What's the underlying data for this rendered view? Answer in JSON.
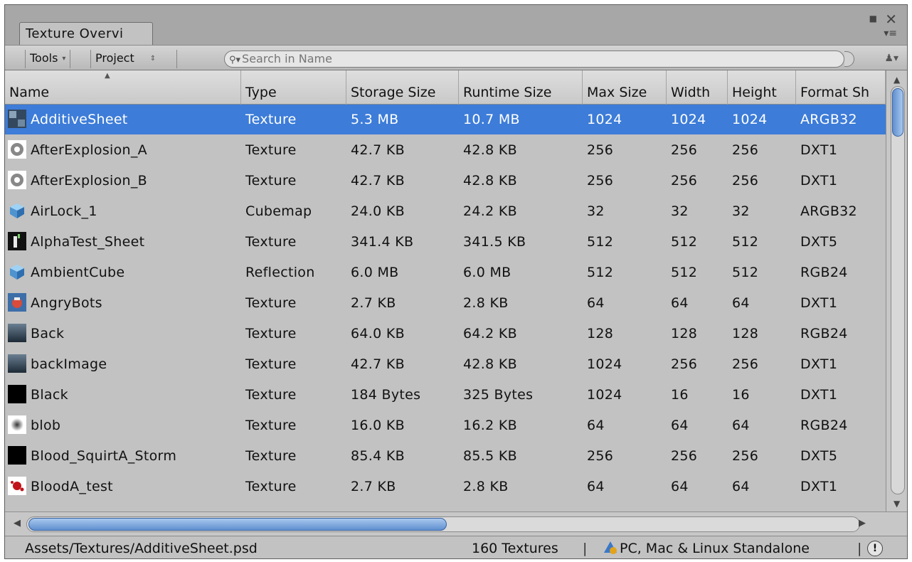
{
  "window": {
    "tab_title": "Texture Overvi"
  },
  "toolbar": {
    "tools_label": "Tools",
    "scope_label": "Project",
    "search_placeholder": "Search in Name"
  },
  "table": {
    "columns": [
      "Name",
      "Type",
      "Storage Size",
      "Runtime Size",
      "Max Size",
      "Width",
      "Height",
      "Format Sh"
    ],
    "rows": [
      {
        "name": "AdditiveSheet",
        "type": "Texture",
        "storage": "5.3 MB",
        "runtime": "10.7 MB",
        "max": "1024",
        "width": "1024",
        "height": "1024",
        "format": "ARGB32",
        "icon": "sheet-thumbnail-icon"
      },
      {
        "name": "AfterExplosion_A",
        "type": "Texture",
        "storage": "42.7 KB",
        "runtime": "42.8 KB",
        "max": "256",
        "width": "256",
        "height": "256",
        "format": "DXT1",
        "icon": "explosion-thumbnail-icon"
      },
      {
        "name": "AfterExplosion_B",
        "type": "Texture",
        "storage": "42.7 KB",
        "runtime": "42.8 KB",
        "max": "256",
        "width": "256",
        "height": "256",
        "format": "DXT1",
        "icon": "explosion-thumbnail-icon"
      },
      {
        "name": "AirLock_1",
        "type": "Cubemap",
        "storage": "24.0 KB",
        "runtime": "24.2 KB",
        "max": "32",
        "width": "32",
        "height": "32",
        "format": "ARGB32",
        "icon": "cubemap-icon"
      },
      {
        "name": "AlphaTest_Sheet",
        "type": "Texture",
        "storage": "341.4 KB",
        "runtime": "341.5 KB",
        "max": "512",
        "width": "512",
        "height": "512",
        "format": "DXT5",
        "icon": "alpha-sheet-thumbnail-icon"
      },
      {
        "name": "AmbientCube",
        "type": "Reflection",
        "storage": "6.0 MB",
        "runtime": "6.0 MB",
        "max": "512",
        "width": "512",
        "height": "512",
        "format": "RGB24",
        "icon": "cubemap-icon"
      },
      {
        "name": "AngryBots",
        "type": "Texture",
        "storage": "2.7 KB",
        "runtime": "2.8 KB",
        "max": "64",
        "width": "64",
        "height": "64",
        "format": "DXT1",
        "icon": "angrybots-thumbnail-icon"
      },
      {
        "name": "Back",
        "type": "Texture",
        "storage": "64.0 KB",
        "runtime": "64.2 KB",
        "max": "128",
        "width": "128",
        "height": "128",
        "format": "RGB24",
        "icon": "gradient-thumbnail-icon"
      },
      {
        "name": "backImage",
        "type": "Texture",
        "storage": "42.7 KB",
        "runtime": "42.8 KB",
        "max": "1024",
        "width": "256",
        "height": "256",
        "format": "DXT1",
        "icon": "gradient-thumbnail-icon"
      },
      {
        "name": "Black",
        "type": "Texture",
        "storage": "184 Bytes",
        "runtime": "325 Bytes",
        "max": "1024",
        "width": "16",
        "height": "16",
        "format": "DXT1",
        "icon": "black-thumbnail-icon"
      },
      {
        "name": "blob",
        "type": "Texture",
        "storage": "16.0 KB",
        "runtime": "16.2 KB",
        "max": "64",
        "width": "64",
        "height": "64",
        "format": "RGB24",
        "icon": "blob-thumbnail-icon"
      },
      {
        "name": "Blood_SquirtA_Storm",
        "type": "Texture",
        "storage": "85.4 KB",
        "runtime": "85.5 KB",
        "max": "256",
        "width": "256",
        "height": "256",
        "format": "DXT5",
        "icon": "black-thumbnail-icon"
      },
      {
        "name": "BloodA_test",
        "type": "Texture",
        "storage": "2.7 KB",
        "runtime": "2.8 KB",
        "max": "64",
        "width": "64",
        "height": "64",
        "format": "DXT1",
        "icon": "blood-splat-thumbnail-icon"
      }
    ]
  },
  "status": {
    "path": "Assets/Textures/AdditiveSheet.psd",
    "count": "160 Textures",
    "separator": "|",
    "platform": "PC, Mac & Linux Standalone"
  },
  "colors": {
    "selection": "#3d7cd8",
    "panel": "#c2c2c2",
    "header": "#d4d4d4"
  }
}
